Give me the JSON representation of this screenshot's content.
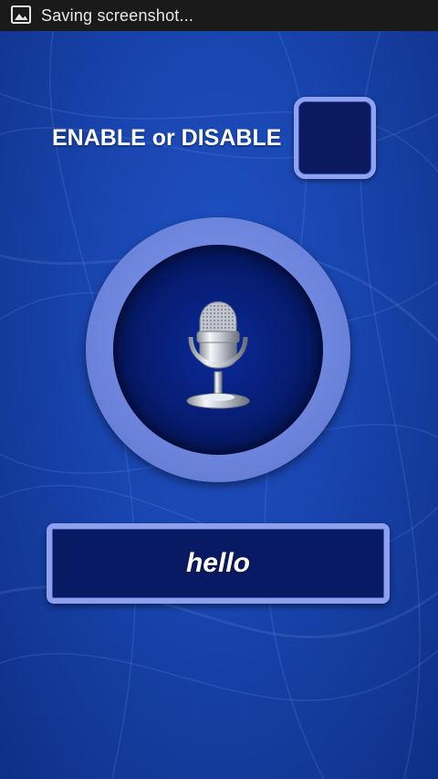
{
  "status_bar": {
    "notification_icon": "image-icon",
    "text": "Saving screenshot..."
  },
  "enable_section": {
    "label": "ENABLE or DISABLE",
    "toggle_checked": false
  },
  "mic_button": {
    "icon": "microphone-icon"
  },
  "speech_output": {
    "text": "hello"
  },
  "colors": {
    "background": "#1a48b4",
    "frame": "#8ea0ec",
    "panel": "#081a63",
    "text": "#ffffff"
  }
}
